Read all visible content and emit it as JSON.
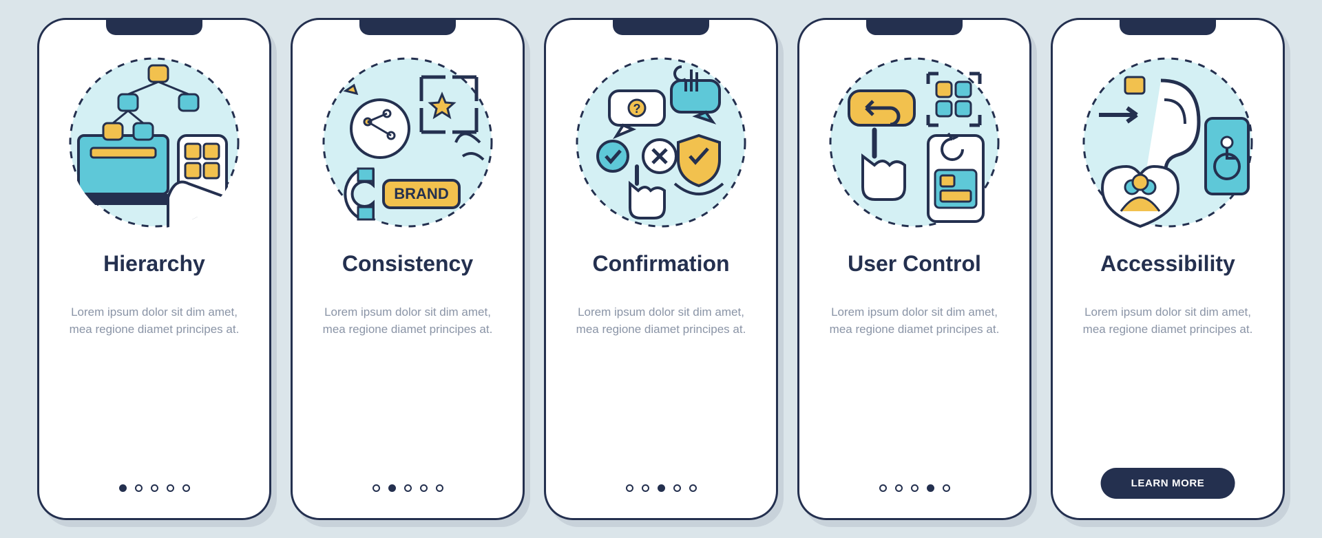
{
  "slides": [
    {
      "title": "Hierarchy",
      "desc": "Lorem ipsum dolor sit dim amet, mea regione diamet principes at.",
      "active_index": 0,
      "has_cta": false
    },
    {
      "title": "Consistency",
      "desc": "Lorem ipsum dolor sit dim amet, mea regione diamet principes at.",
      "active_index": 1,
      "has_cta": false
    },
    {
      "title": "Confirmation",
      "desc": "Lorem ipsum dolor sit dim amet, mea regione diamet principes at.",
      "active_index": 2,
      "has_cta": false
    },
    {
      "title": "User Control",
      "desc": "Lorem ipsum dolor sit dim amet, mea regione diamet principes at.",
      "active_index": 3,
      "has_cta": false
    },
    {
      "title": "Accessibility",
      "desc": "Lorem ipsum dolor sit dim amet, mea regione diamet principes at.",
      "active_index": 4,
      "has_cta": true,
      "cta_label": "LEARN MORE"
    }
  ],
  "pager_count": 5,
  "colors": {
    "navy": "#24304f",
    "yellow": "#f2c14e",
    "cyan": "#5ec8d8",
    "cyan_fill": "#b5e8ef",
    "bg": "#dbe5ea"
  }
}
